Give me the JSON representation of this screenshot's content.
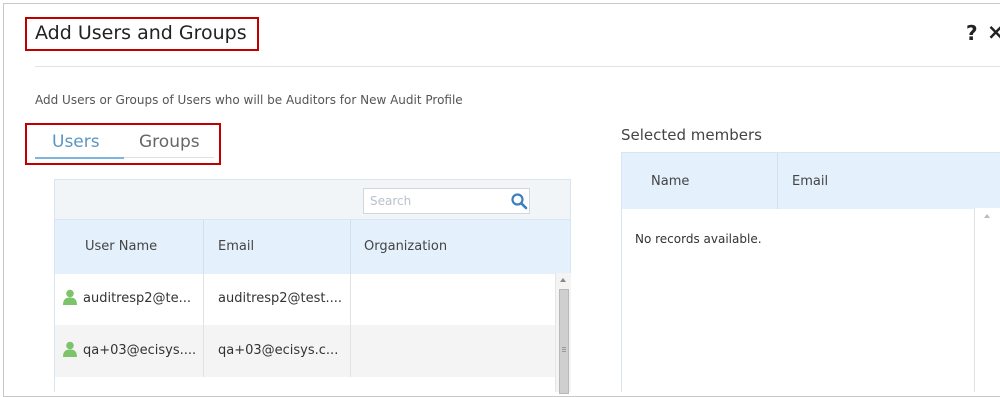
{
  "dialog": {
    "title": "Add Users and Groups",
    "help_icon": "question-mark-icon",
    "close_icon": "close-x-icon",
    "description": "Add Users or Groups of Users who will be Auditors for New Audit Profile"
  },
  "tabs": [
    {
      "label": "Users",
      "active": true
    },
    {
      "label": "Groups",
      "active": false
    }
  ],
  "users_table": {
    "search": {
      "placeholder": "Search",
      "value": "",
      "icon": "search-icon"
    },
    "columns": [
      "User Name",
      "Email",
      "Organization"
    ],
    "rows": [
      {
        "icon": "user-icon",
        "user_name": "auditresp2@te...",
        "email": "auditresp2@test....",
        "organization": ""
      },
      {
        "icon": "user-icon",
        "user_name": "qa+03@ecisys....",
        "email": "qa+03@ecisys.c...",
        "organization": ""
      }
    ]
  },
  "selected_members": {
    "title": "Selected members",
    "columns": [
      "Name",
      "Email"
    ],
    "empty_text": "No records available."
  },
  "colors": {
    "highlight_border": "#c00000",
    "active_tab": "#5b96c3",
    "header_bg": "#e4f0fb",
    "user_icon": "#7cc36a",
    "search_icon": "#3a7fc0"
  }
}
